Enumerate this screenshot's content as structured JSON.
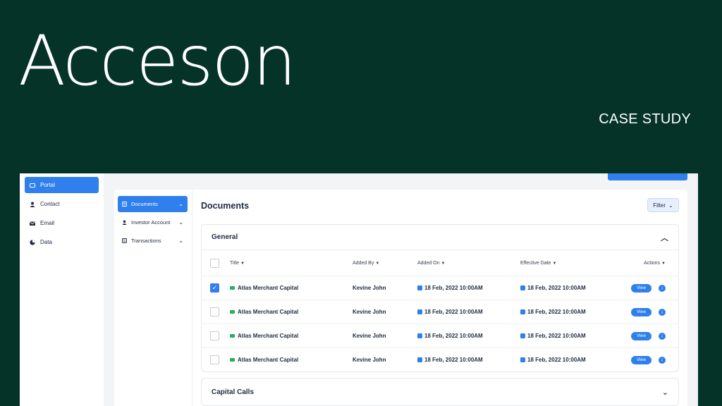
{
  "hero": {
    "title": "Acceson",
    "subtitle": "CASE STUDY"
  },
  "sidebar": {
    "items": [
      {
        "label": "Portal",
        "icon": "portal-icon",
        "active": true
      },
      {
        "label": "Contact",
        "icon": "user-icon",
        "active": false
      },
      {
        "label": "Email",
        "icon": "mail-icon",
        "active": false
      },
      {
        "label": "Data",
        "icon": "pie-chart-icon",
        "active": false
      }
    ]
  },
  "subnav": {
    "items": [
      {
        "label": "Documents",
        "icon": "document-icon",
        "active": true
      },
      {
        "label": "Investor Account",
        "icon": "user-icon",
        "active": false
      },
      {
        "label": "Transactions",
        "icon": "transactions-icon",
        "active": false
      }
    ]
  },
  "main": {
    "title": "Documents",
    "filter_label": "Filter"
  },
  "general": {
    "title": "General",
    "columns": {
      "title": "Title",
      "added_by": "Added By",
      "added_on": "Added On",
      "effective_date": "Effective Date",
      "actions": "Actions"
    },
    "rows": [
      {
        "title": "Atlas Merchant Capital",
        "added_by": "Kevine John",
        "added_on": "18 Feb, 2022 10:00AM",
        "effective_date": "18 Feb, 2022 10:00AM",
        "view": "View",
        "checked": true
      },
      {
        "title": "Atlas Merchant Capital",
        "added_by": "Kevine John",
        "added_on": "18 Feb, 2022 10:00AM",
        "effective_date": "18 Feb, 2022 10:00AM",
        "view": "View",
        "checked": false
      },
      {
        "title": "Atlas Merchant Capital",
        "added_by": "Kevine John",
        "added_on": "18 Feb, 2022 10:00AM",
        "effective_date": "18 Feb, 2022 10:00AM",
        "view": "View",
        "checked": false
      },
      {
        "title": "Atlas Merchant Capital",
        "added_by": "Kevine John",
        "added_on": "18 Feb, 2022 10:00AM",
        "effective_date": "18 Feb, 2022 10:00AM",
        "view": "View",
        "checked": false
      }
    ]
  },
  "capital_calls": {
    "title": "Capital Calls"
  },
  "colors": {
    "background": "#053328",
    "accent": "#2f80ed",
    "folder": "#27ae60"
  }
}
